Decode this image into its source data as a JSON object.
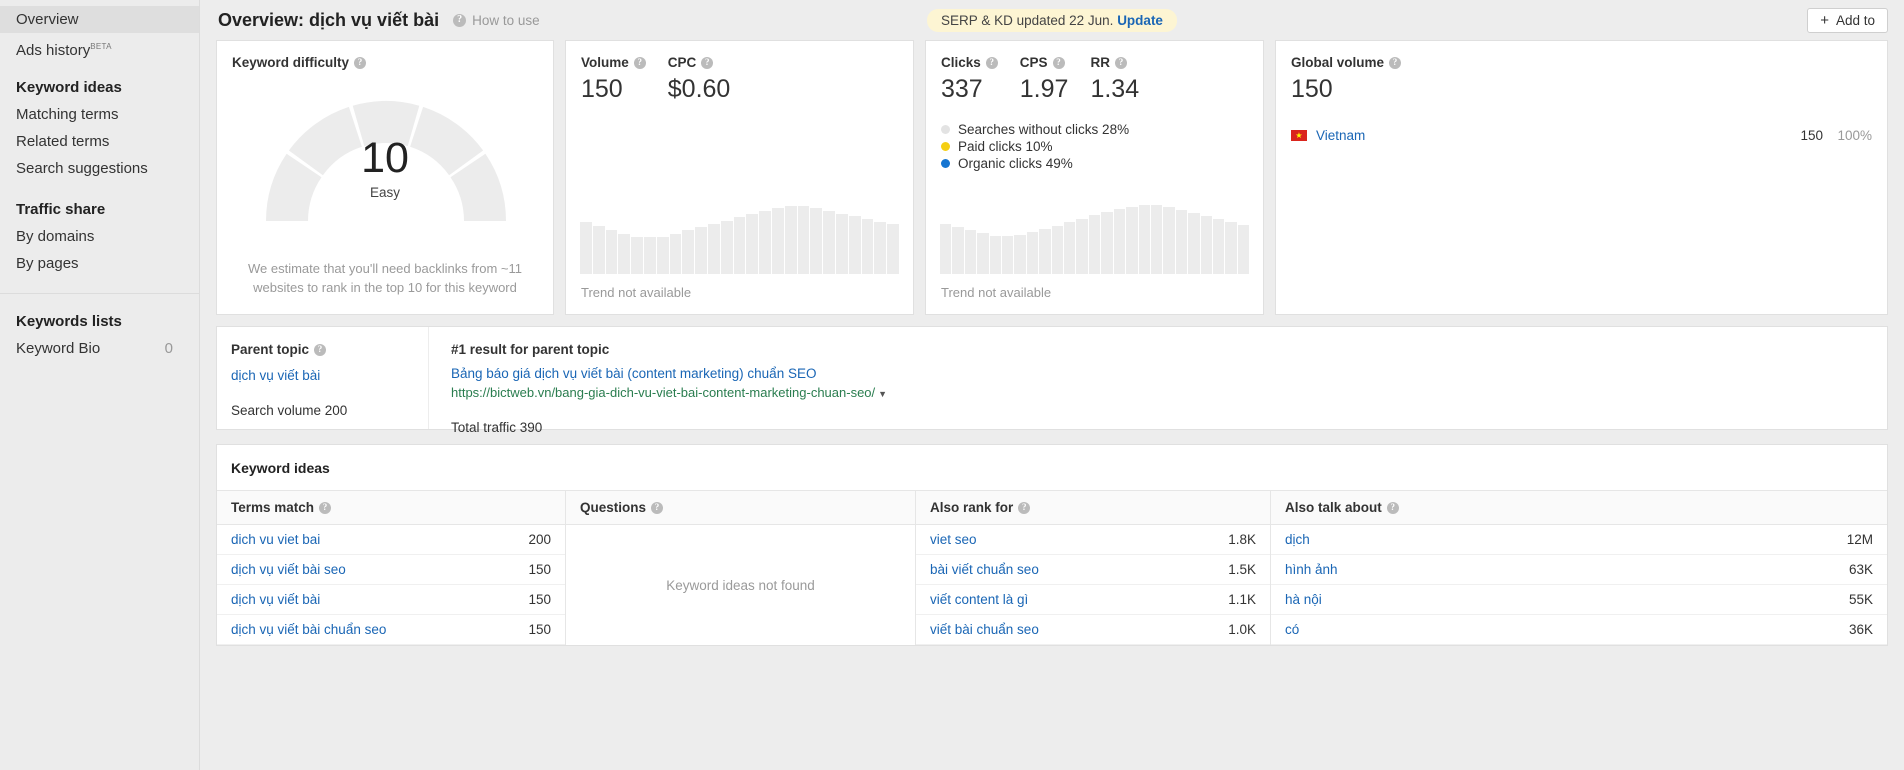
{
  "sidebar": {
    "items": [
      {
        "label": "Overview",
        "active": true
      },
      {
        "label": "Ads history",
        "badge": "BETA"
      }
    ],
    "groups": [
      {
        "title": "Keyword ideas",
        "items": [
          {
            "label": "Matching terms"
          },
          {
            "label": "Related terms"
          },
          {
            "label": "Search suggestions"
          }
        ]
      },
      {
        "title": "Traffic share",
        "items": [
          {
            "label": "By domains"
          },
          {
            "label": "By pages"
          }
        ]
      }
    ],
    "lists": {
      "title": "Keywords lists",
      "items": [
        {
          "label": "Keyword Bio",
          "count": "0"
        }
      ]
    }
  },
  "header": {
    "title": "Overview: dịch vụ viết bài",
    "how_to_use": "How to use",
    "serp_notice": "SERP & KD updated 22 Jun.",
    "serp_update_link": "Update",
    "add_to_label": "Add to"
  },
  "keyword_difficulty": {
    "title": "Keyword difficulty",
    "score": "10",
    "label": "Easy",
    "note": "We estimate that you'll need backlinks from ~11 websites to rank in the top 10 for this keyword"
  },
  "volume_card": {
    "metrics": [
      {
        "label": "Volume",
        "value": "150"
      },
      {
        "label": "CPC",
        "value": "$0.60"
      }
    ],
    "trend_note": "Trend not available"
  },
  "clicks_card": {
    "metrics": [
      {
        "label": "Clicks",
        "value": "337"
      },
      {
        "label": "CPS",
        "value": "1.97"
      },
      {
        "label": "RR",
        "value": "1.34"
      }
    ],
    "legend": [
      {
        "label": "Searches without clicks 28%",
        "color": "#e3e3e3"
      },
      {
        "label": "Paid clicks 10%",
        "color": "#f5cf13"
      },
      {
        "label": "Organic clicks 49%",
        "color": "#1675d1"
      }
    ],
    "trend_note": "Trend not available"
  },
  "global_volume": {
    "title": "Global volume",
    "value": "150",
    "countries": [
      {
        "name": "Vietnam",
        "volume": "150",
        "percent": "100%",
        "flag": "vietnam-flag"
      }
    ]
  },
  "parent_topic": {
    "title": "Parent topic",
    "keyword": "dịch vụ viết bài",
    "search_volume": "Search volume 200",
    "result_title": "#1 result for parent topic",
    "page_title": "Bảng báo giá dịch vụ viết bài (content marketing) chuẩn SEO",
    "page_url": "https://bictweb.vn/bang-gia-dich-vu-viet-bai-content-marketing-chuan-seo/",
    "total_traffic": "Total traffic 390"
  },
  "keyword_ideas": {
    "title": "Keyword ideas",
    "empty_message": "Keyword ideas not found",
    "columns": [
      {
        "header": "Terms match",
        "rows": [
          {
            "keyword": "dich vu viet bai",
            "volume": "200"
          },
          {
            "keyword": "dịch vụ viết bài seo",
            "volume": "150"
          },
          {
            "keyword": "dịch vụ viết bài",
            "volume": "150"
          },
          {
            "keyword": "dịch vụ viết bài chuẩn seo",
            "volume": "150"
          }
        ]
      },
      {
        "header": "Questions",
        "rows": []
      },
      {
        "header": "Also rank for",
        "rows": [
          {
            "keyword": "viet seo",
            "volume": "1.8K"
          },
          {
            "keyword": "bài viết chuẩn seo",
            "volume": "1.5K"
          },
          {
            "keyword": "viết content là gì",
            "volume": "1.1K"
          },
          {
            "keyword": "viết bài chuẩn seo",
            "volume": "1.0K"
          }
        ]
      },
      {
        "header": "Also talk about",
        "rows": [
          {
            "keyword": "dịch",
            "volume": "12M"
          },
          {
            "keyword": "hình ảnh",
            "volume": "63K"
          },
          {
            "keyword": "hà nội",
            "volume": "55K"
          },
          {
            "keyword": "có",
            "volume": "36K"
          }
        ]
      }
    ]
  },
  "chart_data": [
    {
      "type": "bar",
      "title": "Volume trend",
      "note": "Trend not available",
      "categories": [
        "1",
        "2",
        "3",
        "4",
        "5",
        "6",
        "7",
        "8",
        "9",
        "10",
        "11",
        "12",
        "13",
        "14",
        "15",
        "16",
        "17",
        "18",
        "19",
        "20",
        "21",
        "22",
        "23",
        "24",
        "25"
      ],
      "values": [
        52,
        48,
        44,
        40,
        37,
        37,
        37,
        40,
        44,
        47,
        50,
        53,
        57,
        60,
        63,
        66,
        68,
        68,
        66,
        63,
        60,
        58,
        55,
        52,
        50
      ],
      "ylim": [
        0,
        100
      ]
    },
    {
      "type": "bar",
      "title": "Clicks trend",
      "note": "Trend not available",
      "categories": [
        "1",
        "2",
        "3",
        "4",
        "5",
        "6",
        "7",
        "8",
        "9",
        "10",
        "11",
        "12",
        "13",
        "14",
        "15",
        "16",
        "17",
        "18",
        "19",
        "20",
        "21",
        "22",
        "23",
        "24",
        "25"
      ],
      "values": [
        50,
        47,
        44,
        41,
        38,
        38,
        39,
        42,
        45,
        48,
        52,
        55,
        59,
        62,
        65,
        67,
        69,
        69,
        67,
        64,
        61,
        58,
        55,
        52,
        49
      ],
      "ylim": [
        0,
        100
      ]
    },
    {
      "type": "pie",
      "title": "Clicks breakdown",
      "labels": [
        "Searches without clicks",
        "Paid clicks",
        "Organic clicks"
      ],
      "values": [
        28,
        10,
        49
      ],
      "colors": [
        "#e3e3e3",
        "#f5cf13",
        "#1675d1"
      ]
    },
    {
      "type": "gauge",
      "title": "Keyword difficulty",
      "value": 10,
      "ylim": [
        0,
        100
      ],
      "label": "Easy"
    }
  ]
}
